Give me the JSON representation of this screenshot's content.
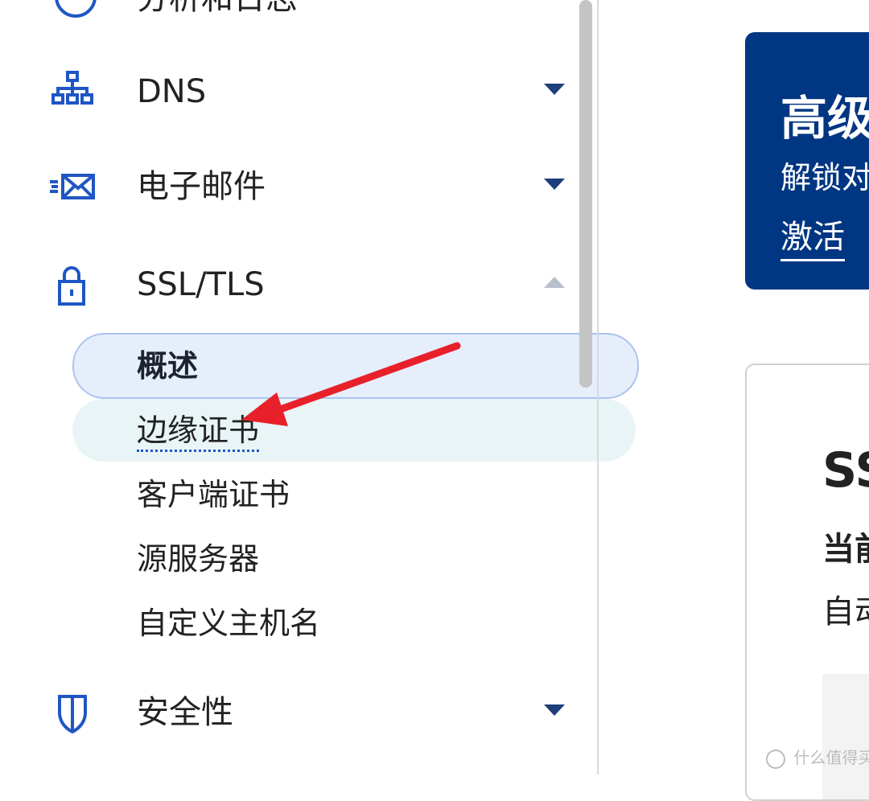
{
  "sidebar": {
    "partial_item": {
      "label": "分析和日志",
      "icon": "clock-icon"
    },
    "items": [
      {
        "label": "DNS",
        "icon": "network-icon",
        "expanded": false
      },
      {
        "label": "电子邮件",
        "icon": "email-icon",
        "expanded": false
      },
      {
        "label": "SSL/TLS",
        "icon": "lock-icon",
        "expanded": true
      },
      {
        "label": "安全性",
        "icon": "shield-icon",
        "expanded": false
      }
    ],
    "ssl_subitems": [
      {
        "label": "概述",
        "active": true
      },
      {
        "label": "边缘证书",
        "hovered": true
      },
      {
        "label": "客户端证书"
      },
      {
        "label": "源服务器"
      },
      {
        "label": "自定义主机名"
      }
    ]
  },
  "promo": {
    "title": "高级",
    "description": "解锁对",
    "link": "激活"
  },
  "card": {
    "title": "SS",
    "subtitle": "当前",
    "value": "自动"
  },
  "watermark": "什么值得买",
  "colors": {
    "accent": "#1f56c4",
    "promo_bg": "#003682",
    "active_bg": "#e6eefc",
    "hover_bg": "#e8f4f6",
    "arrow": "#e8202a"
  }
}
